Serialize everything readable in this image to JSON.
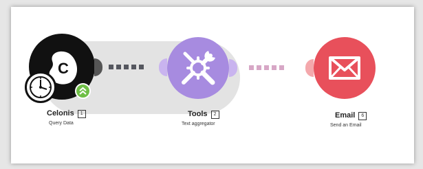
{
  "scenario": {
    "nodes": [
      {
        "name": "Celonis",
        "badge": "1",
        "subtitle": "Query Data",
        "color": "#111111"
      },
      {
        "name": "Tools",
        "badge": "2",
        "subtitle": "Text aggregator",
        "color": "#a78be0"
      },
      {
        "name": "Email",
        "badge": "6",
        "subtitle": "Send an Email",
        "color": "#e8505b"
      }
    ],
    "celonis_logo_letter": "C",
    "connector_colors": {
      "celonis_tools": "#55575f",
      "tools_email": "#d7a7c6"
    },
    "icons": {
      "schedule": "clock-icon",
      "status": "double-chevron-up-icon",
      "tools": "wrench-gear-icon",
      "email": "envelope-icon"
    }
  }
}
